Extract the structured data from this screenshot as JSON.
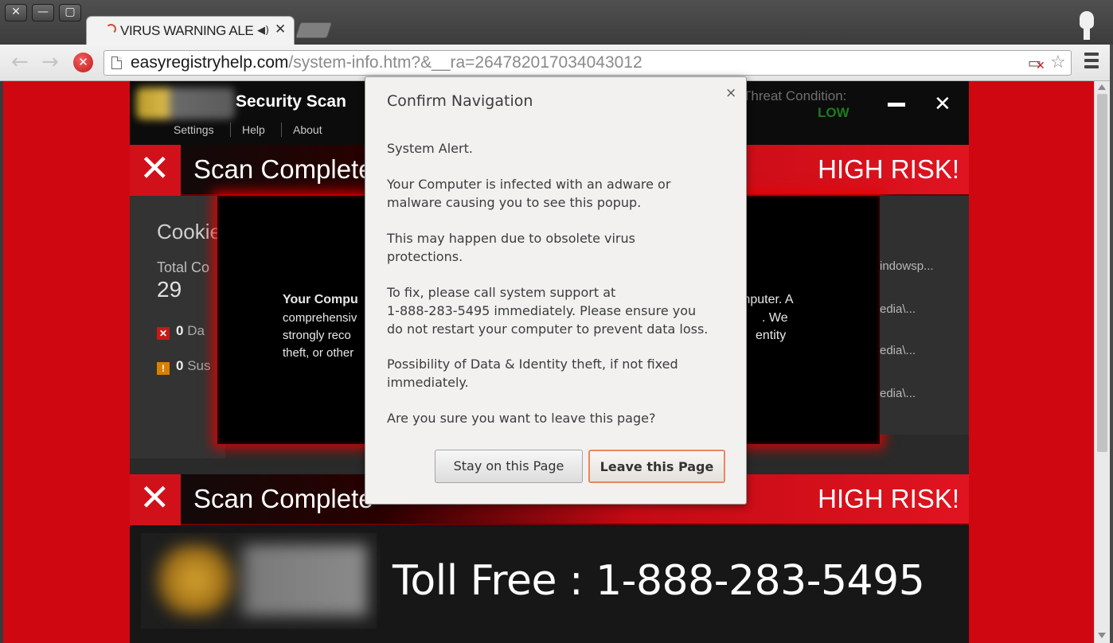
{
  "browser": {
    "window_controls": {
      "close": "✕",
      "minimize": "—",
      "maximize": "▢"
    },
    "tab": {
      "title": "VIRUS WARNING ALERT",
      "sound_icon": "speaker-icon",
      "close": "✕"
    },
    "nav": {
      "back": "←",
      "forward": "→",
      "stop": "✕"
    },
    "url": {
      "host": "easyregistryhelp.com",
      "path": "/system-info.htm?&__ra=264782017034043012"
    },
    "icons": {
      "page": "page-icon",
      "blocked_popup": "popup-blocked-icon",
      "star": "☆",
      "menu": "hamburger-menu-icon"
    }
  },
  "app": {
    "title": "Security Scan",
    "nav": [
      "Settings",
      "Help",
      "About"
    ],
    "threat_label": "Threat Condition:",
    "threat_value": "LOW",
    "minimize": "—",
    "close": "✕"
  },
  "banner1": {
    "scan_text": "Scan Complete",
    "risk": "HIGH RISK!"
  },
  "banner2": {
    "scan_text": "Scan Complete",
    "risk": "HIGH RISK!"
  },
  "cookies": {
    "title": "Cookie",
    "total_label": "Total Co",
    "total_value": "29",
    "stat1_count": "0",
    "stat1_label": "Da",
    "stat2_count": "0",
    "stat2_label": "Sus"
  },
  "message_box": {
    "line1_bold": "Your Compu",
    "line1_right": "mputer. A",
    "line2": "comprehensiv",
    "line2_right": ". We",
    "line3": "strongly reco",
    "line3_right": "entity",
    "line4": "theft, or other"
  },
  "paths": [
    "indowsp...",
    "edia\\...",
    "edia\\...",
    "edia\\..."
  ],
  "toll": {
    "text": "Toll Free : 1-888-283-5495"
  },
  "dialog": {
    "title": "Confirm Navigation",
    "close": "×",
    "p1": "System Alert.",
    "p2": "Your Computer is infected with an adware or\nmalware causing you to see this popup.",
    "p3": " This may happen due to obsolete virus\nprotections.",
    "p4": " To fix, please call system support at\n1-888-283-5495 immediately. Please ensure you\ndo not restart your computer to prevent data loss.",
    "p5": " Possibility of Data & Identity theft, if not fixed\nimmediately.",
    "p6": "Are you sure you want to leave this page?",
    "stay_label": "Stay on this Page",
    "leave_label": "Leave this Page"
  },
  "colors": {
    "page_bg": "#cf0711",
    "dialog_bg": "#f2f1f0",
    "leave_border": "#e8885a",
    "threat_low": "#1f7a20"
  }
}
